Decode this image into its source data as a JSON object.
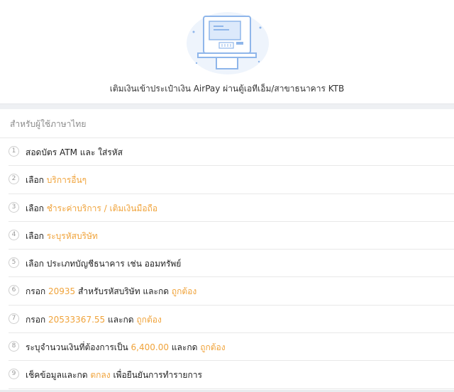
{
  "header": {
    "title": "เติมเงินเข้าประเป๋าเงิน AirPay ผ่านตู้เอทีเอ็ม/สาขาธนาคาร KTB"
  },
  "language_label": "สำหรับผู้ใช้ภาษาไทย",
  "colors": {
    "highlight": "#f0a33a",
    "atm_blue": "#8fb6ea",
    "atm_bg": "#eef4fc"
  },
  "steps": [
    {
      "num": "1",
      "parts": [
        {
          "t": "สอดบัตร ATM และ ใส่รหัส",
          "hl": false
        }
      ]
    },
    {
      "num": "2",
      "parts": [
        {
          "t": "เลือก ",
          "hl": false
        },
        {
          "t": "บริการอื่นๆ",
          "hl": true
        }
      ]
    },
    {
      "num": "3",
      "parts": [
        {
          "t": "เลือก ",
          "hl": false
        },
        {
          "t": "ชำระค่าบริการ / เติมเงินมือถือ",
          "hl": true
        }
      ]
    },
    {
      "num": "4",
      "parts": [
        {
          "t": "เลือก ",
          "hl": false
        },
        {
          "t": "ระบุรหัสบริษัท",
          "hl": true
        }
      ]
    },
    {
      "num": "5",
      "parts": [
        {
          "t": "เลือก ประเภทบัญชีธนาคาร เช่น ออมทรัพย์",
          "hl": false
        }
      ]
    },
    {
      "num": "6",
      "parts": [
        {
          "t": "กรอก ",
          "hl": false
        },
        {
          "t": "20935",
          "hl": true
        },
        {
          "t": " สำหรับรหัสบริษัท และกด ",
          "hl": false
        },
        {
          "t": "ถูกต้อง",
          "hl": true
        }
      ]
    },
    {
      "num": "7",
      "parts": [
        {
          "t": "กรอก ",
          "hl": false
        },
        {
          "t": "20533367.55",
          "hl": true
        },
        {
          "t": " และกด ",
          "hl": false
        },
        {
          "t": "ถูกต้อง",
          "hl": true
        }
      ]
    },
    {
      "num": "8",
      "parts": [
        {
          "t": "ระบุจำนวนเงินที่ต้องการเป็น ",
          "hl": false
        },
        {
          "t": "6,400.00",
          "hl": true
        },
        {
          "t": " และกด ",
          "hl": false
        },
        {
          "t": "ถูกต้อง",
          "hl": true
        }
      ]
    },
    {
      "num": "9",
      "parts": [
        {
          "t": "เช็คข้อมูลและกด ",
          "hl": false
        },
        {
          "t": "ตกลง",
          "hl": true
        },
        {
          "t": " เพื่อยืนยันการทำรายการ",
          "hl": false
        }
      ]
    }
  ]
}
